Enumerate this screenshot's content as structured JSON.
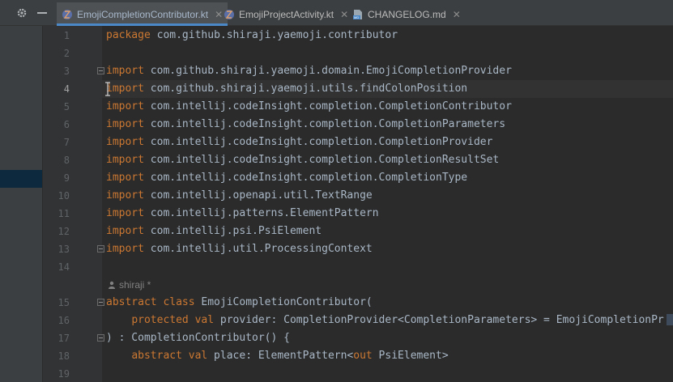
{
  "tabs": [
    {
      "label": "EmojiCompletionContributor.kt",
      "active": true,
      "icon": "kotlin-file-icon"
    },
    {
      "label": "EmojiProjectActivity.kt",
      "active": false,
      "icon": "kotlin-file-icon"
    },
    {
      "label": "CHANGELOG.md",
      "active": false,
      "icon": "markdown-file-icon"
    }
  ],
  "toolbar": {
    "settings_icon": "gear-icon",
    "hide_icon": "minimize-icon"
  },
  "editor": {
    "current_line": 4,
    "lines": [
      {
        "n": "1",
        "kw": "package",
        "rest": " com.github.shiraji.yaemoji.contributor"
      },
      {
        "n": "2",
        "kw": "",
        "rest": ""
      },
      {
        "n": "3",
        "kw": "import",
        "rest": " com.github.shiraji.yaemoji.domain.EmojiCompletionProvider"
      },
      {
        "n": "4",
        "kw": "import",
        "rest": " com.github.shiraji.yaemoji.utils.findColonPosition"
      },
      {
        "n": "5",
        "kw": "import",
        "rest": " com.intellij.codeInsight.completion.CompletionContributor"
      },
      {
        "n": "6",
        "kw": "import",
        "rest": " com.intellij.codeInsight.completion.CompletionParameters"
      },
      {
        "n": "7",
        "kw": "import",
        "rest": " com.intellij.codeInsight.completion.CompletionProvider"
      },
      {
        "n": "8",
        "kw": "import",
        "rest": " com.intellij.codeInsight.completion.CompletionResultSet"
      },
      {
        "n": "9",
        "kw": "import",
        "rest": " com.intellij.codeInsight.completion.CompletionType"
      },
      {
        "n": "10",
        "kw": "import",
        "rest": " com.intellij.openapi.util.TextRange"
      },
      {
        "n": "11",
        "kw": "import",
        "rest": " com.intellij.patterns.ElementPattern"
      },
      {
        "n": "12",
        "kw": "import",
        "rest": " com.intellij.psi.PsiElement"
      },
      {
        "n": "13",
        "kw": "import",
        "rest": " com.intellij.util.ProcessingContext"
      },
      {
        "n": "14",
        "kw": "",
        "rest": ""
      },
      {
        "n": "15",
        "kw": "abstract class",
        "rest": " EmojiCompletionContributor("
      },
      {
        "n": "16",
        "indent": "    ",
        "kw": "protected val",
        "rest": " provider: CompletionProvider<CompletionParameters> = EmojiCompletionPr"
      },
      {
        "n": "17",
        "kw": "",
        "rest": ") : CompletionContributor() {"
      },
      {
        "n": "18",
        "indent": "    ",
        "kw": "abstract val",
        "rest": " place: ElementPattern<",
        "kw2": "out",
        "rest2": " PsiElement>"
      },
      {
        "n": "19",
        "kw": "",
        "rest": ""
      }
    ],
    "author_hint": "shiraji *"
  },
  "colors": {
    "background": "#2b2b2b",
    "keyword": "#cc7832",
    "identifier": "#a9b7c6",
    "line_number": "#606366",
    "accent": "#4a88c7"
  }
}
